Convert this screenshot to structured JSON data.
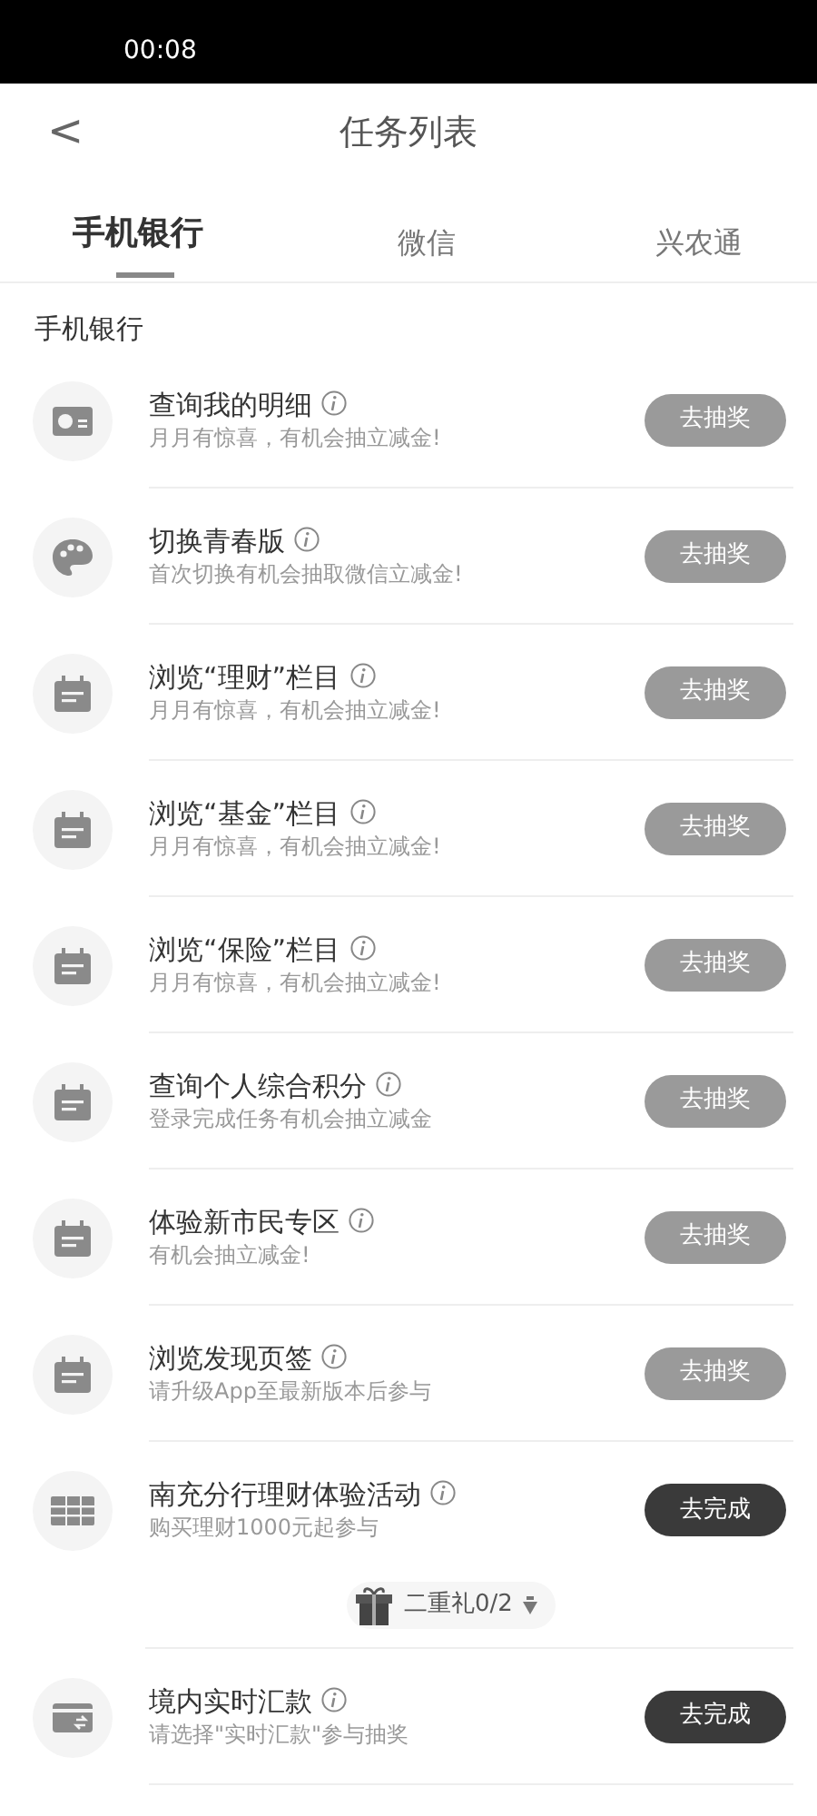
{
  "status_bar": {
    "time": "00:08"
  },
  "header": {
    "back": "<",
    "title": "任务列表"
  },
  "tabs": [
    {
      "label": "手机银行",
      "selected": true
    },
    {
      "label": "微信",
      "selected": false
    },
    {
      "label": "兴农通",
      "selected": false
    }
  ],
  "section": "手机银行",
  "tasks": [
    {
      "title": "查询我的明细",
      "subtitle": "月月有惊喜，有机会抽立减金!",
      "button": {
        "label": "去抽奖",
        "kind": "draw"
      }
    },
    {
      "title": "切换青春版",
      "subtitle": "首次切换有机会抽取微信立减金!",
      "button": {
        "label": "去抽奖",
        "kind": "draw"
      }
    },
    {
      "title": "浏览“理财”栏目",
      "subtitle": "月月有惊喜，有机会抽立减金!",
      "button": {
        "label": "去抽奖",
        "kind": "draw"
      }
    },
    {
      "title": "浏览“基金”栏目",
      "subtitle": "月月有惊喜，有机会抽立减金!",
      "button": {
        "label": "去抽奖",
        "kind": "draw"
      }
    },
    {
      "title": "浏览“保险”栏目",
      "subtitle": "月月有惊喜，有机会抽立减金!",
      "button": {
        "label": "去抽奖",
        "kind": "draw"
      }
    },
    {
      "title": "查询个人综合积分",
      "subtitle": "登录完成任务有机会抽立减金",
      "button": {
        "label": "去抽奖",
        "kind": "draw"
      }
    },
    {
      "title": "体验新市民专区",
      "subtitle": "有机会抽立减金!",
      "button": {
        "label": "去抽奖",
        "kind": "draw"
      }
    },
    {
      "title": "浏览发现页签",
      "subtitle": "请升级App至最新版本后参与",
      "button": {
        "label": "去抽奖",
        "kind": "draw"
      }
    },
    {
      "title": "南充分行理财体验活动",
      "subtitle": "购买理财1000元起参与",
      "button": {
        "label": "去完成",
        "kind": "complete"
      },
      "reward": "二重礼0/2"
    },
    {
      "title": "境内实时汇款",
      "subtitle": "请选择\"实时汇款\"参与抽奖",
      "button": {
        "label": "去完成",
        "kind": "complete"
      }
    }
  ]
}
